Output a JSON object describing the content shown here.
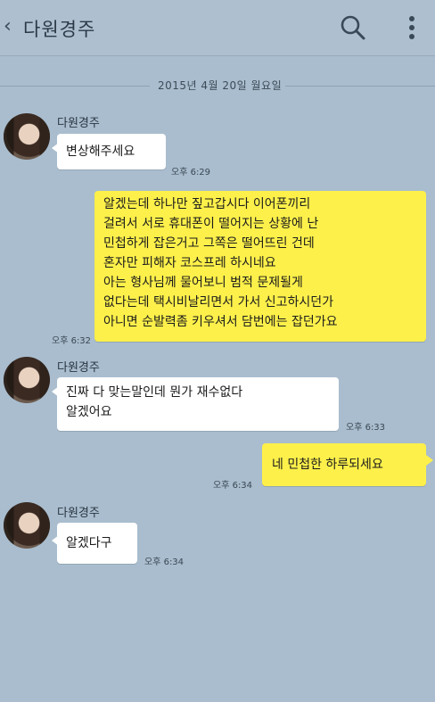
{
  "header": {
    "back_glyph": "‹",
    "title": "다원경주",
    "search_icon": "search-icon",
    "menu_icon": "more-vertical-icon"
  },
  "date_divider": "2015년 4월 20일 월요일",
  "messages": [
    {
      "from": "다원경주",
      "text": [
        "변상해주세요"
      ],
      "time": "오후 6:29"
    },
    {
      "from": "me",
      "text": [
        "알겠는데 하나만 짚고갑시다 이어폰끼리",
        "걸려서 서로 휴대폰이 떨어지는 상황에 난",
        "민첩하게 잡은거고 그쪽은 떨어뜨린 건데",
        "혼자만 피해자 코스프레 하시네요",
        "아는 형사님께 물어보니 범적 문제될게",
        "없다는데 택시비날리면서 가서 신고하시던가",
        "아니면 순발력좀 키우셔서 담번에는 잡던가요"
      ],
      "time": "오후 6:32"
    },
    {
      "from": "다원경주",
      "text": [
        "진짜 다 맞는말인데 뭔가 재수없다",
        "알겠어요"
      ],
      "time": "오후 6:33"
    },
    {
      "from": "me",
      "text": [
        "네 민첩한 하루되세요"
      ],
      "time": "오후 6:34"
    },
    {
      "from": "다원경주",
      "text": [
        "알겠다구"
      ],
      "time": "오후 6:34"
    }
  ]
}
